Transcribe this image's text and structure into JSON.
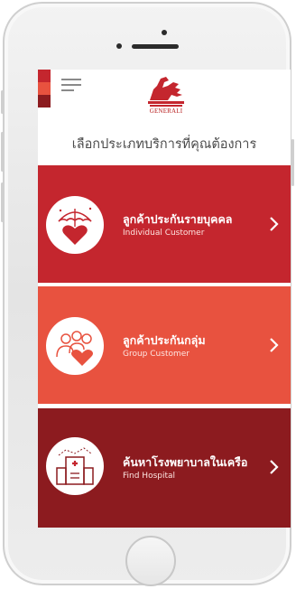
{
  "app": {
    "brand_name": "GENERALI",
    "heading": "เลือกประเภทบริการที่คุณต้องการ"
  },
  "colors": {
    "brand_red": "#c4262e",
    "light_red": "#e8523f",
    "dark_red": "#8c1b1f",
    "white": "#ffffff"
  },
  "cards": [
    {
      "title": "ลูกค้าประกันรายบุคคล",
      "subtitle": "Individual Customer",
      "icon": "umbrella-heart-icon",
      "color": "#c4262e"
    },
    {
      "title": "ลูกค้าประกันกลุ่ม",
      "subtitle": "Group Customer",
      "icon": "group-heart-icon",
      "color": "#e8523f"
    },
    {
      "title": "ค้นหาโรงพยาบาลในเครือ",
      "subtitle": "Find Hospital",
      "icon": "hospital-icon",
      "color": "#8c1b1f"
    }
  ]
}
